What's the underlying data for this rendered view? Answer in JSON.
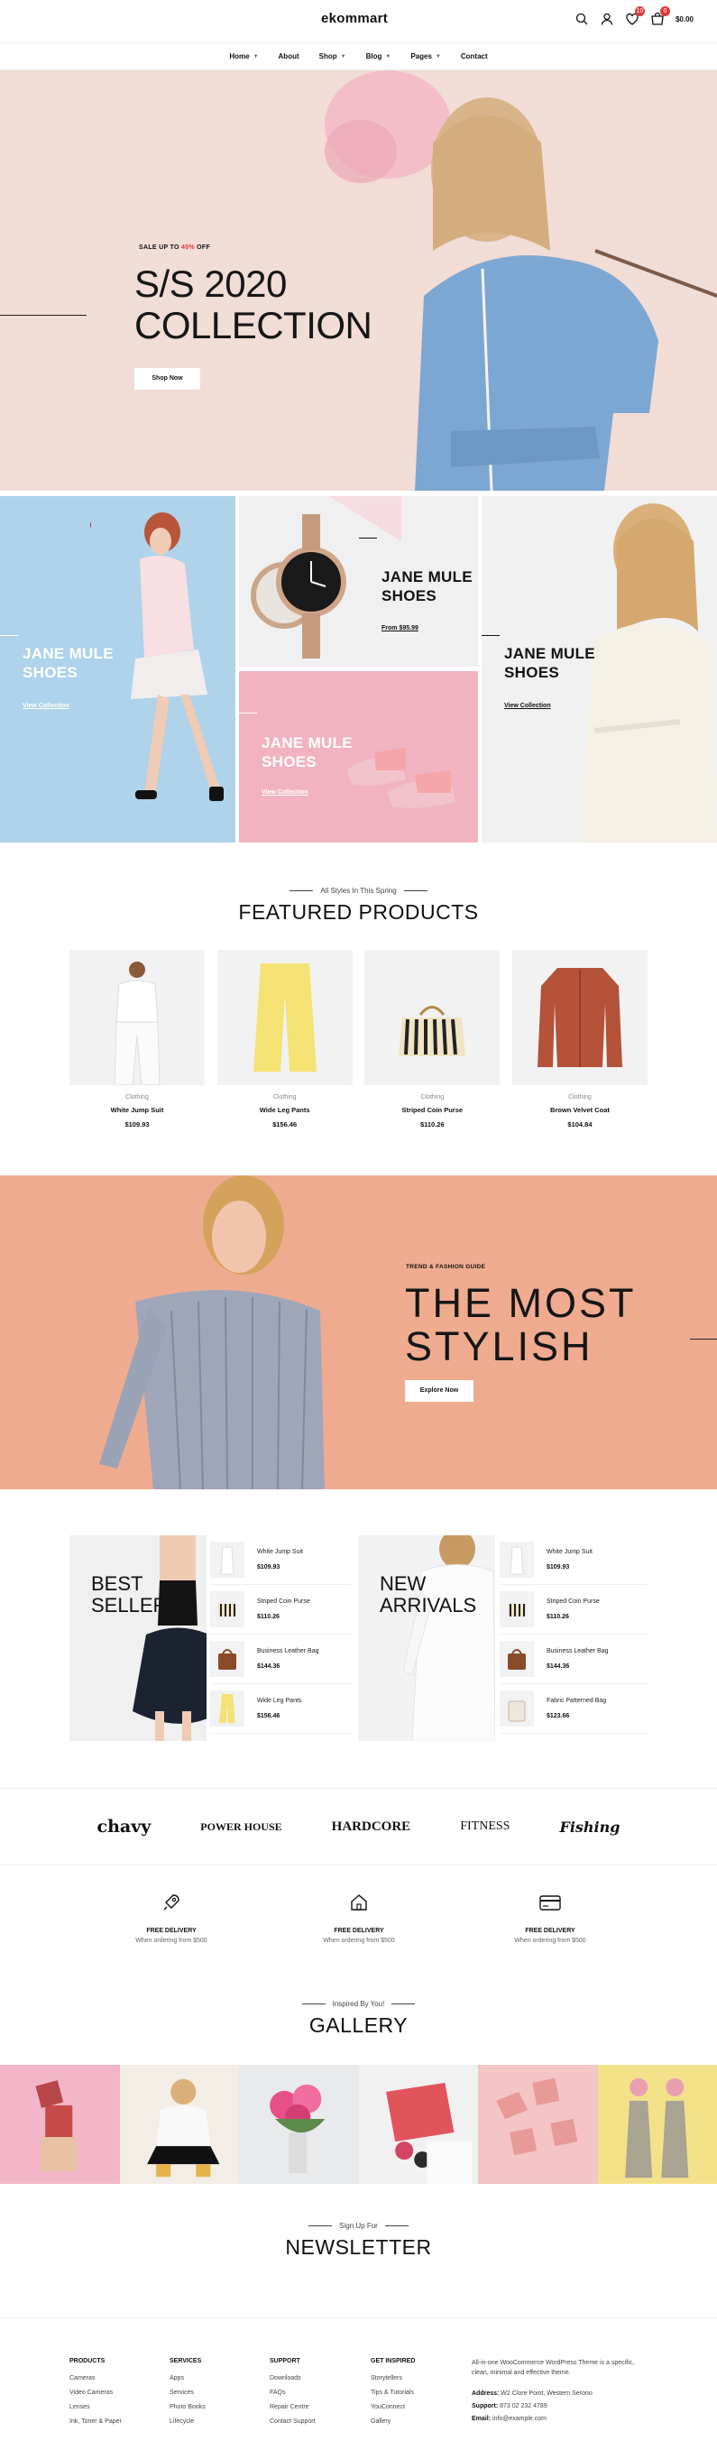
{
  "header": {
    "logo": "ekommart",
    "wishlist_count": "10",
    "cart_count": "0",
    "cart_total": "$0.00"
  },
  "nav": {
    "items": [
      "Home",
      "About",
      "Shop",
      "Blog",
      "Pages",
      "Contact"
    ]
  },
  "hero": {
    "small_prefix": "SALE UP TO ",
    "small_accent": "40%",
    "small_suffix": " OFF",
    "title_line1": "S/S 2020",
    "title_line2": "COLLECTION",
    "button": "Shop Now",
    "accent_color": "#e23a3a"
  },
  "categories": {
    "cat1": {
      "title_line1": "JANE MULE",
      "title_line2": "SHOES",
      "link": "View Collection"
    },
    "cat2": {
      "title_line1": "JANE MULE",
      "title_line2": "SHOES",
      "link": "From $95.99"
    },
    "cat3": {
      "title_line1": "JANE MULE",
      "title_line2": "SHOES",
      "link": "View Collection"
    },
    "cat4": {
      "title_line1": "JANE MULE",
      "title_line2": "SHOES",
      "link": "View Collection"
    }
  },
  "featured": {
    "subtitle": "All Styles In This Spring",
    "title": "FEATURED PRODUCTS",
    "products": [
      {
        "category": "Clothing",
        "name": "White Jump Suit",
        "price": "$109.93"
      },
      {
        "category": "Clothing",
        "name": "Wide Leg Pants",
        "price": "$156.46"
      },
      {
        "category": "Clothing",
        "name": "Striped Coin Purse",
        "price": "$110.26"
      },
      {
        "category": "Clothing",
        "name": "Brown Velvet Coat",
        "price": "$104.84"
      }
    ]
  },
  "promo": {
    "small": "TREND & FASHION GUIDE",
    "title_line1": "THE MOST",
    "title_line2": "STYLISH",
    "button": "Explore Now"
  },
  "best_seller": {
    "title_line1": "BEST",
    "title_line2": "SELLER",
    "items": [
      {
        "name": "White Jump Suit",
        "price": "$109.93"
      },
      {
        "name": "Striped Coin Purse",
        "price": "$110.26"
      },
      {
        "name": "Business Leather Bag",
        "price": "$144.36"
      },
      {
        "name": "Wide Leg Pants",
        "price": "$156.46"
      }
    ]
  },
  "new_arrivals": {
    "title_line1": "NEW",
    "title_line2": "ARRIVALS",
    "items": [
      {
        "name": "White Jump Suit",
        "price": "$109.93"
      },
      {
        "name": "Striped Coin Purse",
        "price": "$110.26"
      },
      {
        "name": "Business Leather Bag",
        "price": "$144.36"
      },
      {
        "name": "Fabric Patterned Bag",
        "price": "$123.66"
      }
    ]
  },
  "brands": [
    "chavy",
    "POWER HOUSE",
    "HARDCORE",
    "FITNESS",
    "Fishing"
  ],
  "features": [
    {
      "title": "FREE DELIVERY",
      "sub": "When ordering from $500",
      "icon": "rocket-icon"
    },
    {
      "title": "FREE DELIVERY",
      "sub": "When ordering from $500",
      "icon": "home-icon"
    },
    {
      "title": "FREE DELIVERY",
      "sub": "When ordering from $500",
      "icon": "card-icon"
    }
  ],
  "gallery": {
    "subtitle": "Inspired By You!",
    "title": "GALLERY"
  },
  "newsletter": {
    "subtitle": "Sign Up For",
    "title": "NEWSLETTER"
  },
  "footer": {
    "cols": [
      {
        "title": "PRODUCTS",
        "items": [
          "Cameras",
          "Video Cameras",
          "Lenses",
          "Ink, Toner & Paper"
        ]
      },
      {
        "title": "SERVICES",
        "items": [
          "Apps",
          "Services",
          "Photo Books",
          "Lifecycle"
        ]
      },
      {
        "title": "SUPPORT",
        "items": [
          "Downloads",
          "FAQs",
          "Repair Centre",
          "Contact Support"
        ]
      },
      {
        "title": "GET INSPIRED",
        "items": [
          "Storytellers",
          "Tips & Tutorials",
          "YouConnect",
          "Gallery"
        ]
      }
    ],
    "about": "All-in-one WooCommerce WordPress Theme is a specific, clean, minimal and effective theme.",
    "address_label": "Address:",
    "address": "W2 Clore Point, Western Serono",
    "support_label": "Support:",
    "support": "873 02 232 4789",
    "email_label": "Email:",
    "email": "info@example.com"
  }
}
